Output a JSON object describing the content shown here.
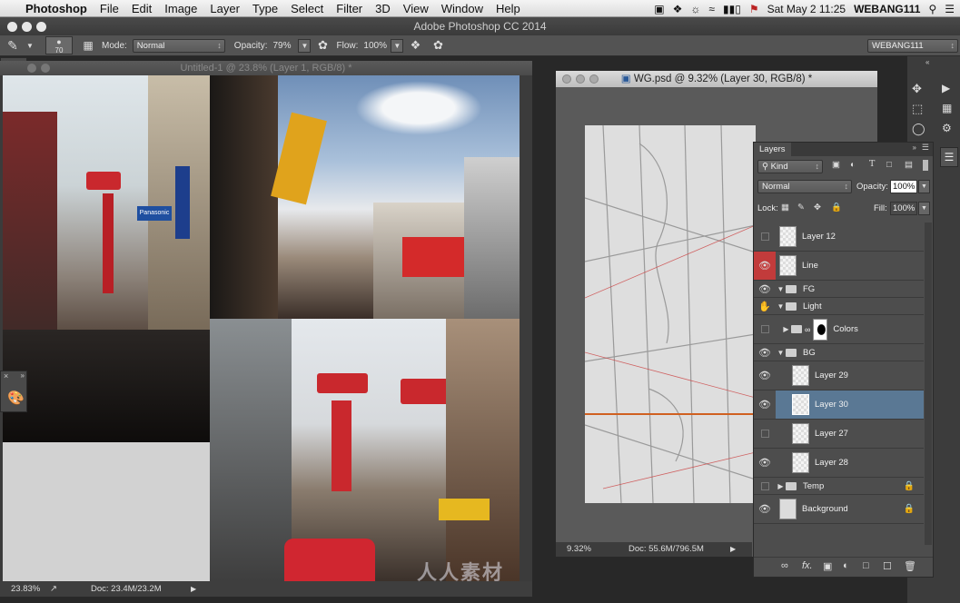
{
  "menubar": {
    "apple": "",
    "items": [
      "Photoshop",
      "File",
      "Edit",
      "Image",
      "Layer",
      "Type",
      "Select",
      "Filter",
      "3D",
      "View",
      "Window",
      "Help"
    ],
    "datetime": "Sat May 2  11:25",
    "user": "WEBANG111"
  },
  "window": {
    "title": "Adobe Photoshop CC 2014"
  },
  "options": {
    "brush_size": "70",
    "mode_label": "Mode:",
    "mode_value": "Normal",
    "opacity_label": "Opacity:",
    "opacity_value": "79%",
    "flow_label": "Flow:",
    "flow_value": "100%",
    "workspace": "WEBANG111"
  },
  "doc1": {
    "title": "Untitled-1 @ 23.8% (Layer 1, RGB/8) *",
    "zoom": "23.83%",
    "doc_size": "Doc: 23.4M/23.2M"
  },
  "doc2": {
    "title": "WG.psd @ 9.32% (Layer 30, RGB/8) *",
    "zoom": "9.32%",
    "doc_size": "Doc: 55.6M/796.5M"
  },
  "layers_panel": {
    "tab_label": "Layers",
    "filter_kind": "Kind",
    "blend_mode": "Normal",
    "opacity_label": "Opacity:",
    "opacity_value": "100%",
    "lock_label": "Lock:",
    "fill_label": "Fill:",
    "fill_value": "100%",
    "layers": [
      {
        "name": "Layer 12",
        "kind": "layer",
        "visible": false
      },
      {
        "name": "Line",
        "kind": "layer",
        "visible": true
      },
      {
        "name": "FG",
        "kind": "group",
        "visible": true
      },
      {
        "name": "Light",
        "kind": "group",
        "visible": true
      },
      {
        "name": "Colors",
        "kind": "group",
        "visible": false
      },
      {
        "name": "BG",
        "kind": "group",
        "visible": true
      },
      {
        "name": "Layer 29",
        "kind": "layer",
        "visible": true
      },
      {
        "name": "Layer 30",
        "kind": "layer",
        "visible": true,
        "selected": true
      },
      {
        "name": "Layer 27",
        "kind": "layer",
        "visible": false
      },
      {
        "name": "Layer 28",
        "kind": "layer",
        "visible": true
      },
      {
        "name": "Temp",
        "kind": "group",
        "visible": false,
        "locked": true
      },
      {
        "name": "Background",
        "kind": "layer",
        "visible": true,
        "locked": true
      }
    ]
  },
  "photo_signs": {
    "panasonic": "Panasonic",
    "watermark": "人人素材"
  },
  "colors": {
    "accent_selected": "#5a7894",
    "eye_highlight": "#c23b3b",
    "sign_red": "#d42a2a"
  }
}
